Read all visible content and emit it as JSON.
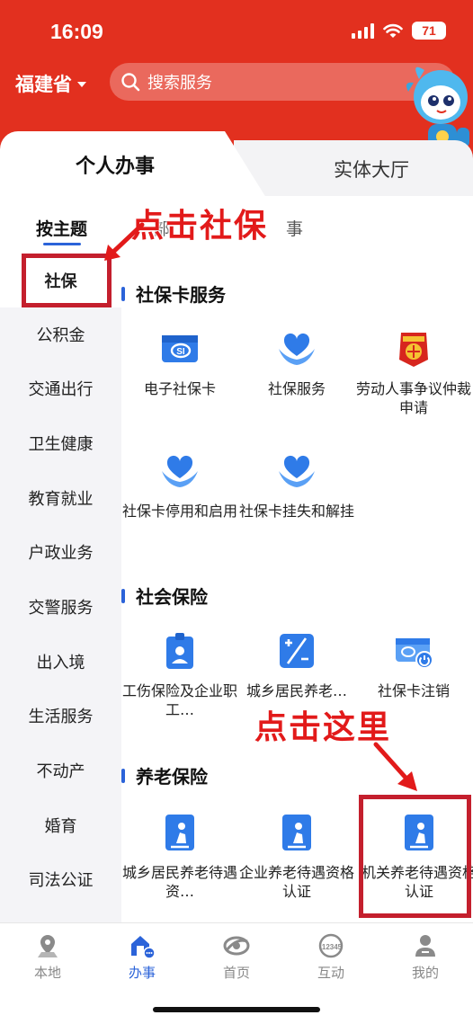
{
  "status_bar": {
    "time": "16:09",
    "battery": "71"
  },
  "header": {
    "province": "福建省",
    "search_placeholder": "搜索服务"
  },
  "tabs": {
    "personal": "个人办事",
    "hall": "实体大厅"
  },
  "subtabs": {
    "by_theme": "按主题",
    "by_dept_fragment": "部",
    "by_dept_fragment2": "事"
  },
  "sidebar": {
    "items": [
      "社保",
      "公积金",
      "交通出行",
      "卫生健康",
      "教育就业",
      "户政业务",
      "交警服务",
      "出入境",
      "生活服务",
      "不动产",
      "婚育",
      "司法公证"
    ],
    "active_index": 0
  },
  "sections": [
    {
      "title": "社保卡服务",
      "items": [
        {
          "label": "电子社保卡",
          "icon": "social-card-icon"
        },
        {
          "label": "社保服务",
          "icon": "heart-hands-icon"
        },
        {
          "label": "劳动人事争议仲裁申请",
          "icon": "arbitration-emblem-icon"
        },
        {
          "label": "社保卡停用和启用",
          "icon": "heart-hands-icon"
        },
        {
          "label": "社保卡挂失和解挂",
          "icon": "heart-hands-icon"
        }
      ]
    },
    {
      "title": "社会保险",
      "items": [
        {
          "label": "工伤保险及企业职工…",
          "icon": "id-badge-icon"
        },
        {
          "label": "城乡居民养老…",
          "icon": "calculator-icon"
        },
        {
          "label": "社保卡注销",
          "icon": "card-power-icon"
        }
      ]
    },
    {
      "title": "养老保险",
      "items": [
        {
          "label": "城乡居民养老待遇资…",
          "icon": "elderly-book-icon"
        },
        {
          "label": "企业养老待遇资格认证",
          "icon": "elderly-book-icon"
        },
        {
          "label": "机关养老待遇资格认证",
          "icon": "elderly-book-icon"
        }
      ]
    }
  ],
  "annotations": {
    "click_social": "点击社保",
    "click_here": "点击这里"
  },
  "bottom_nav": [
    "本地",
    "办事",
    "首页",
    "互动",
    "我的"
  ],
  "bottom_nav_active": 1,
  "colors": {
    "header_red": "#e2301f",
    "accent_blue": "#2b63d9",
    "annotation_red": "#c41f2d"
  }
}
